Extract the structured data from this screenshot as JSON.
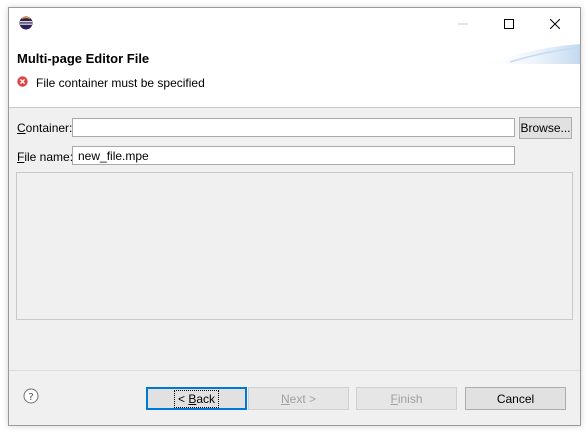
{
  "dialog": {
    "title": "Multi-page Editor File",
    "error_message": "File container must be specified"
  },
  "form": {
    "container_label_prefix": "C",
    "container_label_rest": "ontainer:",
    "container_value": "",
    "browse_label": "Browse...",
    "filename_label_prefix": "F",
    "filename_label_rest": "ile name:",
    "filename_value": "new_file.mpe"
  },
  "buttons": {
    "back_prefix": "< ",
    "back_mnemonic": "B",
    "back_rest": "ack",
    "next_mnemonic": "N",
    "next_rest": "ext >",
    "finish_mnemonic": "F",
    "finish_rest": "inish",
    "cancel": "Cancel"
  },
  "icons": {
    "app": "eclipse-icon",
    "error": "error-icon",
    "help": "help-icon",
    "minimize": "minimize-icon",
    "maximize": "maximize-icon",
    "close": "close-icon"
  },
  "colors": {
    "accent": "#0078d7",
    "error": "#e04343",
    "dialog_bg": "#f0f0f0"
  }
}
